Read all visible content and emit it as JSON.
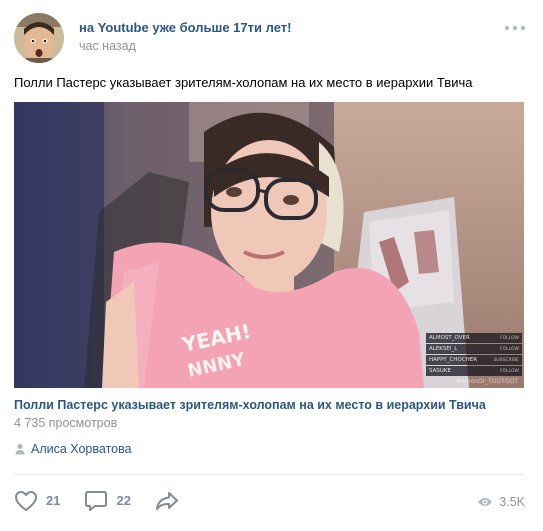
{
  "post": {
    "author": "на Youtube уже больше 17ти лет!",
    "time": "час назад",
    "text": "Полли Пастерс указывает зрителям-холопам на их место в иерархии Твича"
  },
  "video": {
    "title": "Полли Пастерс указывает зрителям-холопам на их место в иерархии Твича",
    "views": "4 735 просмотров",
    "chat": [
      {
        "user": "ALMOST_OVER",
        "action": "FOLLOW"
      },
      {
        "user": "ALEKSEI_L",
        "action": "FOLLOW"
      },
      {
        "user": "HAPPY_CHOCHER",
        "action": "SUBSCRIBE"
      },
      {
        "user": "SASUKE",
        "action": "FOLLOW"
      }
    ],
    "watermark": "#nmonOr_TOOTOOT"
  },
  "signer": {
    "name": "Алиса Хорватова",
    "icon": "user-icon"
  },
  "stats": {
    "likes": "21",
    "comments": "22",
    "views": "3.5K"
  },
  "colors": {
    "link": "#2a5885",
    "meta": "#939393",
    "action": "#828a99",
    "divider": "#e7e8ec"
  }
}
